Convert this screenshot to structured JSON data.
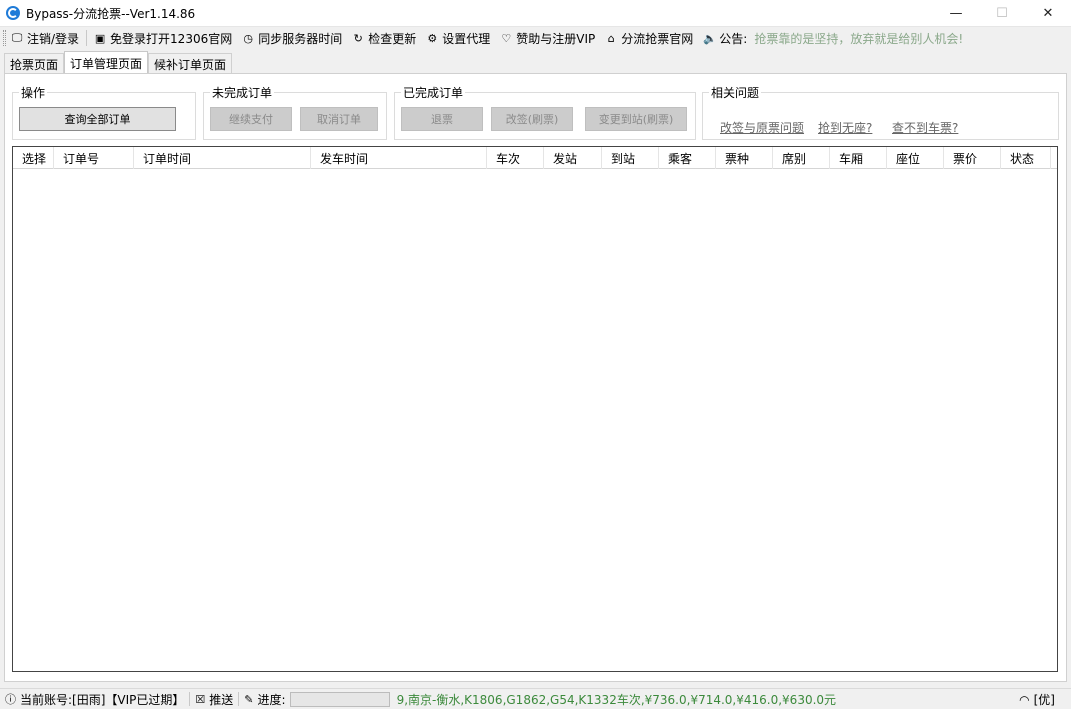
{
  "window": {
    "title": "Bypass-分流抢票--Ver1.14.86",
    "minimize": "—",
    "maximize": "☐",
    "close": "✕"
  },
  "toolbar": {
    "items": [
      {
        "label": "注销/登录",
        "icon": "monitor-icon"
      },
      {
        "label": "免登录打开12306官网",
        "icon": "window-icon"
      },
      {
        "label": "同步服务器时间",
        "icon": "clock-icon"
      },
      {
        "label": "检查更新",
        "icon": "refresh-icon"
      },
      {
        "label": "设置代理",
        "icon": "gear-icon"
      },
      {
        "label": "赞助与注册VIP",
        "icon": "heart-icon"
      },
      {
        "label": "分流抢票官网",
        "icon": "home-icon"
      },
      {
        "label": "公告:",
        "icon": "speaker-icon"
      }
    ],
    "notice": "抢票靠的是坚持，放弃就是给别人机会!"
  },
  "tabs": [
    {
      "label": "抢票页面",
      "active": false
    },
    {
      "label": "订单管理页面",
      "active": true
    },
    {
      "label": "候补订单页面",
      "active": false
    }
  ],
  "groups": {
    "operations": {
      "title": "操作",
      "query_all": "查询全部订单"
    },
    "unfinished": {
      "title": "未完成订单",
      "continue_pay": "继续支付",
      "cancel_order": "取消订单"
    },
    "finished": {
      "title": "已完成订单",
      "refund": "退票",
      "reschedule": "改签(刷票)",
      "change_station": "变更到站(刷票)"
    },
    "faq": {
      "title": "相关问题",
      "links": [
        "改签与原票问题",
        "抢到无座?",
        "查不到车票?"
      ]
    }
  },
  "grid": {
    "columns": [
      "选择",
      "订单号",
      "订单时间",
      "发车时间",
      "车次",
      "发站",
      "到站",
      "乘客",
      "票种",
      "席别",
      "车厢",
      "座位",
      "票价",
      "状态"
    ],
    "rows": []
  },
  "statusbar": {
    "account": "当前账号:[田雨]【VIP已过期】",
    "push": "推送",
    "progress_label": "进度:",
    "route_info": "9,南京-衡水,K1806,G1862,G54,K1332车次,¥736.0,¥714.0,¥416.0,¥630.0元",
    "right_label": "[优]"
  }
}
